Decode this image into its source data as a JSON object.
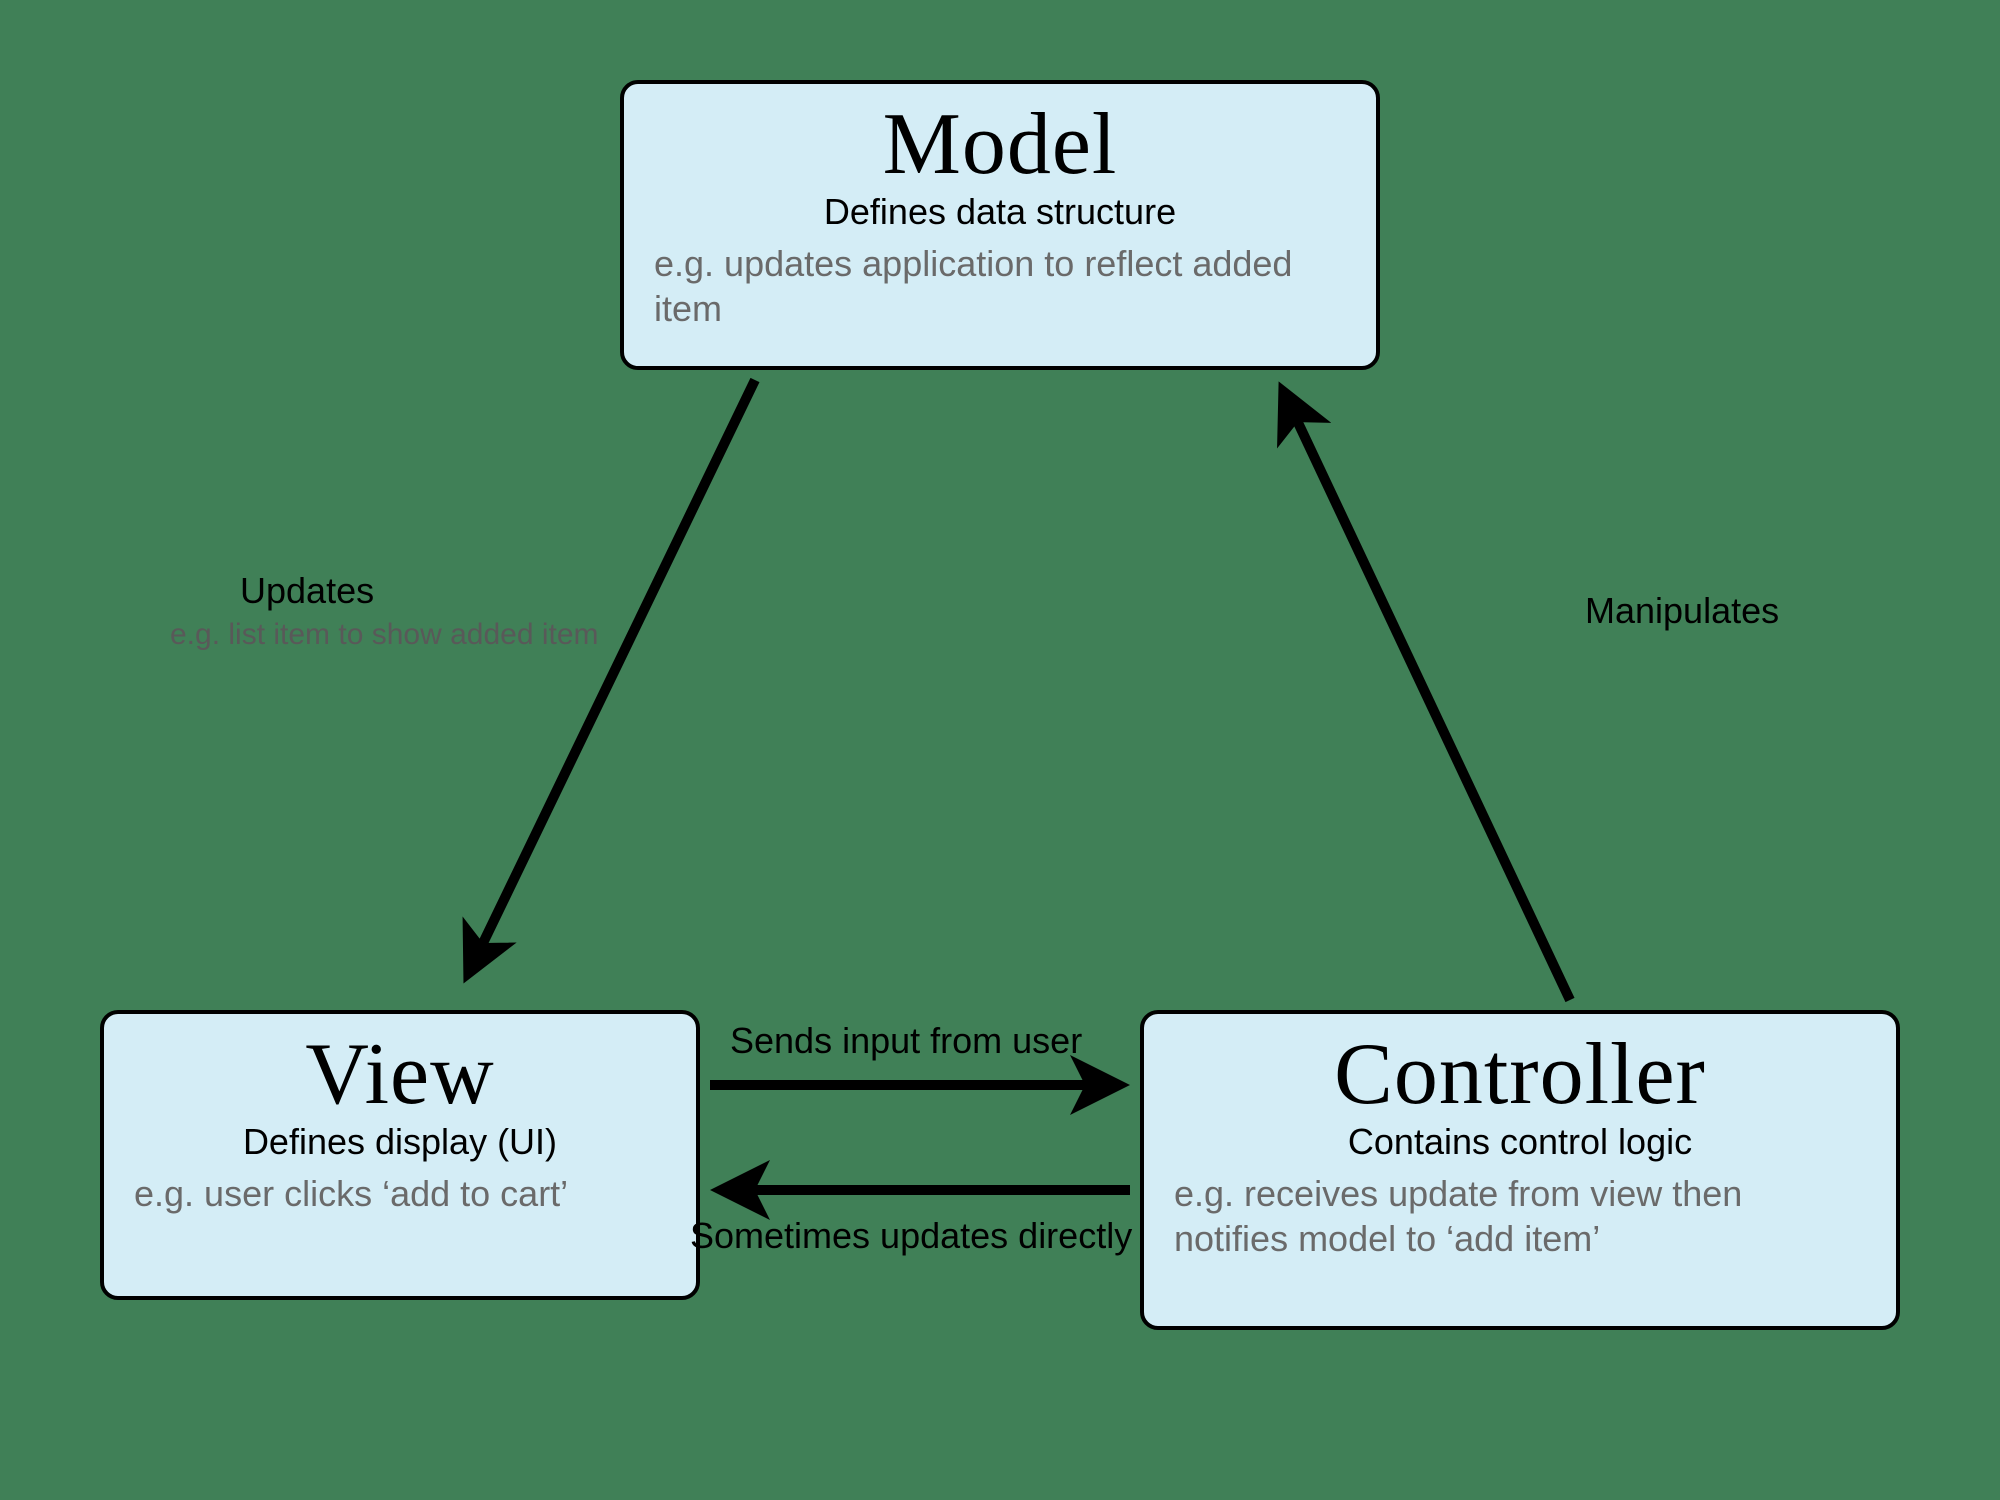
{
  "nodes": {
    "model": {
      "title": "Model",
      "subtitle": "Defines data structure",
      "example": "e.g. updates application to reflect added item"
    },
    "view": {
      "title": "View",
      "subtitle": "Defines display (UI)",
      "example": "e.g. user clicks ‘add to cart’"
    },
    "controller": {
      "title": "Controller",
      "subtitle": "Contains control logic",
      "example": "e.g. receives update from view then notifies model to ‘add item’"
    }
  },
  "edges": {
    "model_to_view": {
      "label": "Updates",
      "sub": "e.g. list item to show added item"
    },
    "controller_to_model": {
      "label": "Manipulates"
    },
    "view_to_controller": {
      "label": "Sends input from user"
    },
    "controller_to_view": {
      "label": "Sometimes updates directly"
    }
  }
}
